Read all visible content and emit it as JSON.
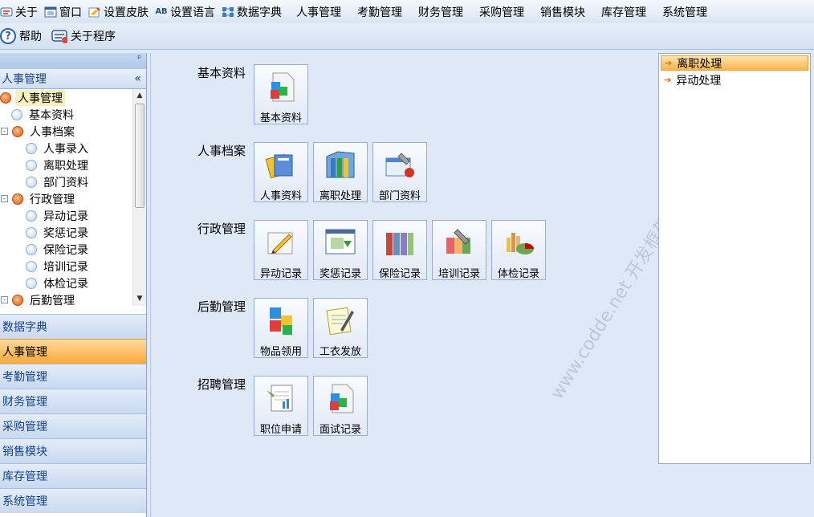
{
  "menubar": {
    "items": [
      {
        "label": "关于",
        "icon": "about-icon"
      },
      {
        "label": "窗口",
        "icon": "window-icon"
      },
      {
        "label": "设置皮肤",
        "icon": "skin-icon"
      },
      {
        "label": "设置语言",
        "icon": "language-icon",
        "icon_text": "AB"
      },
      {
        "label": "数据字典",
        "icon": "dictionary-icon"
      },
      {
        "label": "人事管理"
      },
      {
        "label": "考勤管理"
      },
      {
        "label": "财务管理"
      },
      {
        "label": "采购管理"
      },
      {
        "label": "销售模块"
      },
      {
        "label": "库存管理"
      },
      {
        "label": "系统管理"
      }
    ]
  },
  "toolbar": {
    "help_label": "帮助",
    "about_program_label": "关于程序"
  },
  "left_panel": {
    "pin_glyph": "ᵖ",
    "header_title": "人事管理",
    "collapse_glyph": "«",
    "tree": [
      {
        "label": "人事管理",
        "type": "folder",
        "level": 0,
        "selected": true
      },
      {
        "label": "基本资料",
        "type": "leaf",
        "level": 1
      },
      {
        "label": "人事档案",
        "type": "folder",
        "level": 1,
        "expander": "-"
      },
      {
        "label": "人事录入",
        "type": "leaf",
        "level": 2
      },
      {
        "label": "离职处理",
        "type": "leaf",
        "level": 2
      },
      {
        "label": "部门资料",
        "type": "leaf",
        "level": 2
      },
      {
        "label": "行政管理",
        "type": "folder",
        "level": 1,
        "expander": "-"
      },
      {
        "label": "异动记录",
        "type": "leaf",
        "level": 2
      },
      {
        "label": "奖惩记录",
        "type": "leaf",
        "level": 2
      },
      {
        "label": "保险记录",
        "type": "leaf",
        "level": 2
      },
      {
        "label": "培训记录",
        "type": "leaf",
        "level": 2
      },
      {
        "label": "体检记录",
        "type": "leaf",
        "level": 2
      },
      {
        "label": "后勤管理",
        "type": "folder",
        "level": 1,
        "expander": "-"
      }
    ],
    "nav": [
      {
        "label": "数据字典",
        "active": false
      },
      {
        "label": "人事管理",
        "active": true
      },
      {
        "label": "考勤管理",
        "active": false
      },
      {
        "label": "财务管理",
        "active": false
      },
      {
        "label": "采购管理",
        "active": false
      },
      {
        "label": "销售模块",
        "active": false
      },
      {
        "label": "库存管理",
        "active": false
      },
      {
        "label": "系统管理",
        "active": false
      }
    ]
  },
  "main": {
    "sections": [
      {
        "title": "基本资料",
        "tiles": [
          {
            "label": "基本资料",
            "icon": "cubes-document-icon"
          }
        ]
      },
      {
        "title": "人事档案",
        "tiles": [
          {
            "label": "人事资料",
            "icon": "personnel-files-icon"
          },
          {
            "label": "离职处理",
            "icon": "binders-icon"
          },
          {
            "label": "部门资料",
            "icon": "department-wrench-icon"
          }
        ]
      },
      {
        "title": "行政管理",
        "tiles": [
          {
            "label": "异动记录",
            "icon": "pencil-note-icon"
          },
          {
            "label": "奖惩记录",
            "icon": "award-window-icon"
          },
          {
            "label": "保险记录",
            "icon": "books-icon"
          },
          {
            "label": "培训记录",
            "icon": "training-tools-icon"
          },
          {
            "label": "体检记录",
            "icon": "chart-icon"
          }
        ]
      },
      {
        "title": "后勤管理",
        "tiles": [
          {
            "label": "物品领用",
            "icon": "cubes-icon"
          },
          {
            "label": "工衣发放",
            "icon": "notepad-pen-icon"
          }
        ]
      },
      {
        "title": "招聘管理",
        "tiles": [
          {
            "label": "职位申请",
            "icon": "application-form-icon"
          },
          {
            "label": "面试记录",
            "icon": "interview-document-icon"
          }
        ]
      }
    ],
    "watermark": "www.codde.net 开发框架"
  },
  "right_panel": {
    "items": [
      {
        "label": "离职处理",
        "selected": true
      },
      {
        "label": "异动处理",
        "selected": false
      }
    ]
  }
}
